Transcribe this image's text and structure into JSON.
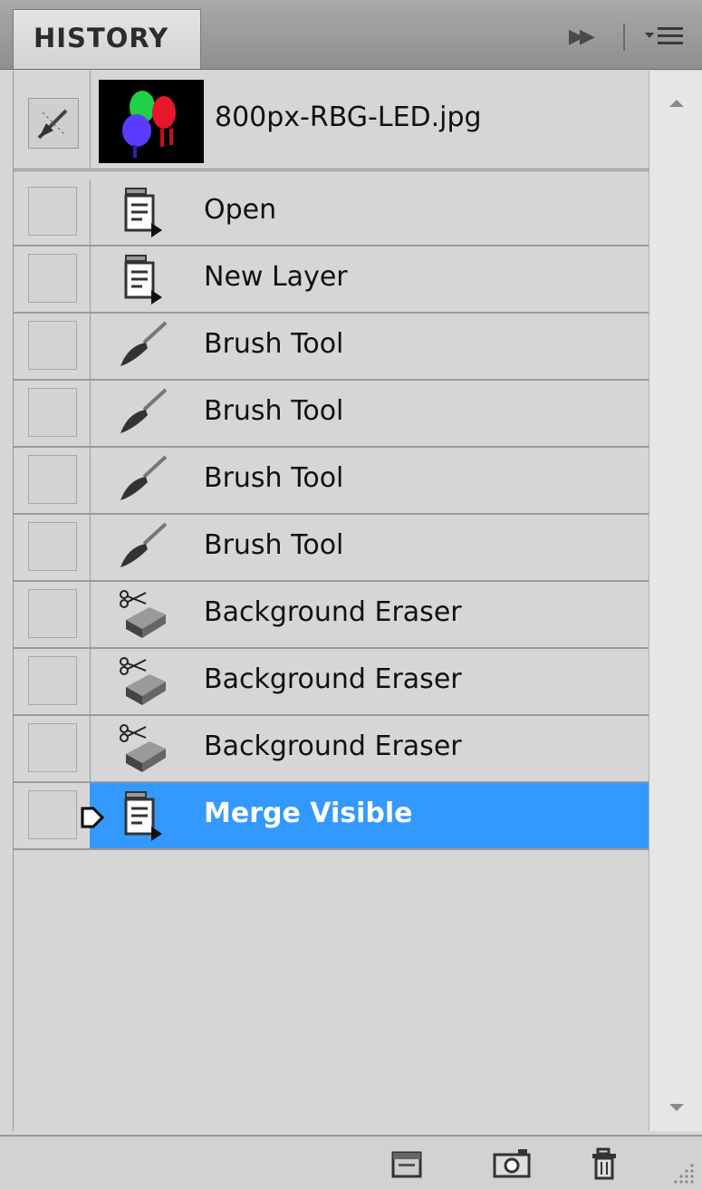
{
  "panel": {
    "tab_label": "HISTORY",
    "snapshot": {
      "name": "800px-RBG-LED.jpg",
      "icon": "history-brush-icon"
    },
    "items": [
      {
        "label": "Open",
        "icon": "document-action-icon"
      },
      {
        "label": "New Layer",
        "icon": "document-action-icon"
      },
      {
        "label": "Brush Tool",
        "icon": "brush-icon"
      },
      {
        "label": "Brush Tool",
        "icon": "brush-icon"
      },
      {
        "label": "Brush Tool",
        "icon": "brush-icon"
      },
      {
        "label": "Brush Tool",
        "icon": "brush-icon"
      },
      {
        "label": "Background Eraser",
        "icon": "background-eraser-icon"
      },
      {
        "label": "Background Eraser",
        "icon": "background-eraser-icon"
      },
      {
        "label": "Background Eraser",
        "icon": "background-eraser-icon"
      },
      {
        "label": "Merge Visible",
        "icon": "document-action-icon",
        "selected": true
      }
    ],
    "footer_buttons": [
      "new-document-from-state-icon",
      "new-snapshot-camera-icon",
      "trash-icon"
    ],
    "colors": {
      "selection": "#3399ff",
      "panel": "#d6d6d6"
    }
  }
}
